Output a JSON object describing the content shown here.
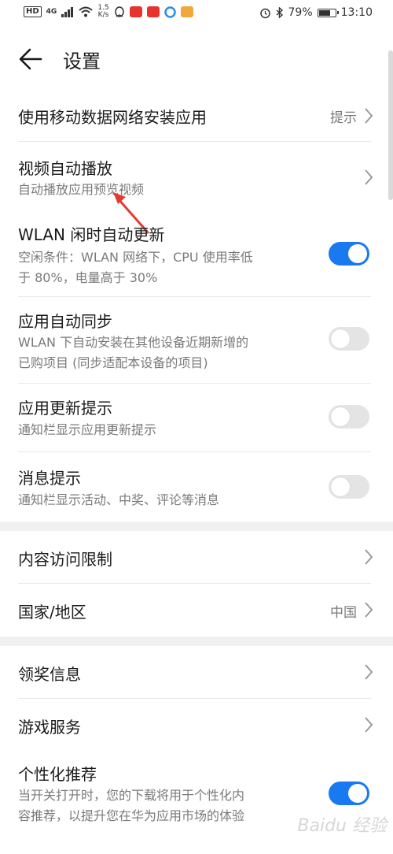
{
  "status_bar": {
    "hd": "HD",
    "net_gen": "4G",
    "speed_value": "1.5",
    "speed_unit": "K/s",
    "battery": "79%",
    "time": "13:10",
    "app_icon_colors": [
      "#e8322e",
      "#e8322e",
      "#2a8cf0",
      "#f3a63a"
    ]
  },
  "header": {
    "title": "设置"
  },
  "rows": [
    {
      "title": "使用移动数据网络安装应用",
      "value": "提示",
      "control": "chevron"
    },
    {
      "title": "视频自动播放",
      "subtitle": "自动播放应用预览视频",
      "control": "chevron"
    },
    {
      "title": "WLAN 闲时自动更新",
      "subtitle_line1": "空闲条件：WLAN 网络下，CPU 使用率低",
      "subtitle_line2": "于 80%，电量高于 30%",
      "control": "toggle",
      "on": true
    },
    {
      "title": "应用自动同步",
      "subtitle_line1": "WLAN 下自动安装在其他设备近期新增的",
      "subtitle_line2": "已购项目 (同步适配本设备的项目)",
      "control": "toggle",
      "on": false
    },
    {
      "title": "应用更新提示",
      "subtitle": "通知栏显示应用更新提示",
      "control": "toggle",
      "on": false
    },
    {
      "title": "消息提示",
      "subtitle": "通知栏显示活动、中奖、评论等消息",
      "control": "toggle",
      "on": false
    },
    {
      "title": "内容访问限制",
      "control": "chevron"
    },
    {
      "title": "国家/地区",
      "value": "中国",
      "control": "chevron"
    },
    {
      "title": "领奖信息",
      "control": "chevron"
    },
    {
      "title": "游戏服务",
      "control": "chevron"
    },
    {
      "title": "个性化推荐",
      "subtitle_line1": "当开关打开时，您的下载将用于个性化内",
      "subtitle_line2": "容推荐，以提升您在华为应用市场的体验",
      "control": "toggle",
      "on": true
    }
  ],
  "watermark": "Baidu 经验",
  "colors": {
    "accent": "#1979f0",
    "annotation_arrow": "#e53a34"
  }
}
